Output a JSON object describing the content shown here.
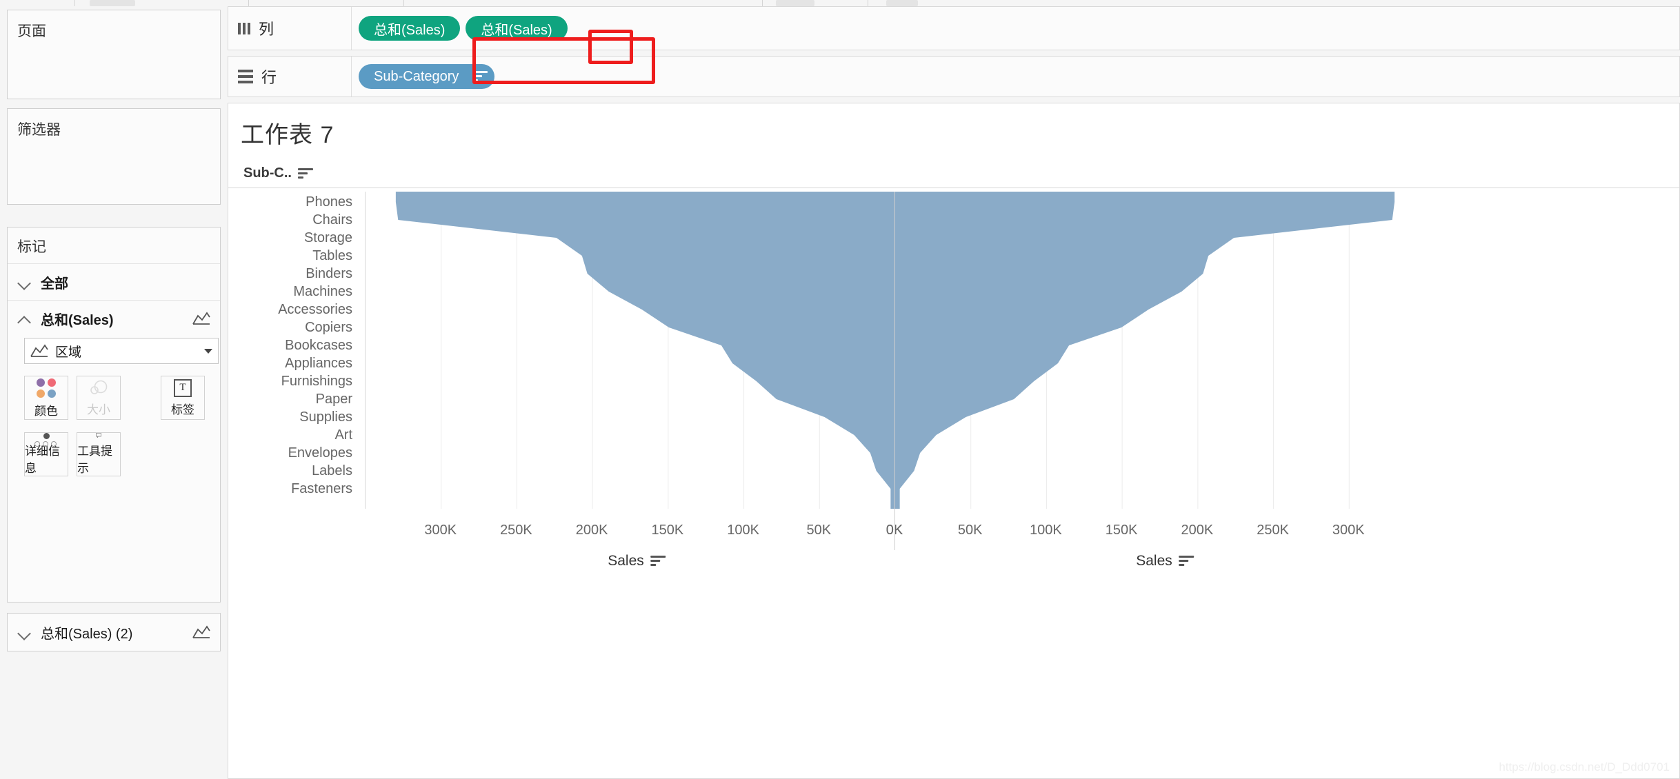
{
  "left_panel": {
    "pages": {
      "title": "页面"
    },
    "filters": {
      "title": "筛选器"
    },
    "marks": {
      "title": "标记",
      "group_all": "全部",
      "group_sales": "总和(Sales)",
      "group_sales2": "总和(Sales) (2)",
      "mark_type": "区域",
      "buttons": [
        {
          "label": "颜色",
          "icon": "color-dots-icon"
        },
        {
          "label": "大小",
          "icon": "size-circles-icon"
        },
        {
          "label": "标签",
          "icon": "label-t-icon"
        },
        {
          "label": "详细信息",
          "icon": "detail-dots-icon"
        },
        {
          "label": "工具提示",
          "icon": "tooltip-bubble-icon"
        }
      ]
    }
  },
  "shelves": {
    "columns": {
      "label": "列",
      "icon": "columns-icon",
      "pills": [
        {
          "text": "总和(Sales)",
          "color": "#0fa47f"
        },
        {
          "text": "总和(Sales)",
          "color": "#0fa47f"
        }
      ]
    },
    "rows": {
      "label": "行",
      "icon": "rows-icon",
      "pills": [
        {
          "text": "Sub-Category",
          "color": "#5b9bc4",
          "sorted": true
        }
      ]
    }
  },
  "worksheet": {
    "title": "工作表 7",
    "row_field_header": "Sub-C..",
    "watermark": "https://blog.csdn.net/D_Ddd0701"
  },
  "chart_data": {
    "type": "area",
    "title": "工作表 7",
    "orientation": "horizontal-mirrored-butterfly",
    "categories": [
      "Phones",
      "Chairs",
      "Storage",
      "Tables",
      "Binders",
      "Machines",
      "Accessories",
      "Copiers",
      "Bookcases",
      "Appliances",
      "Furnishings",
      "Paper",
      "Supplies",
      "Art",
      "Envelopes",
      "Labels",
      "Fasteners"
    ],
    "series": [
      {
        "name": "Sales (left, reversed axis)",
        "axis": "left",
        "values": [
          330007,
          328449,
          223844,
          206966,
          203413,
          189239,
          167380,
          149528,
          114880,
          107532,
          91705,
          78479,
          46674,
          27119,
          16476,
          12486,
          3024
        ]
      },
      {
        "name": "Sales (right axis)",
        "axis": "right",
        "values": [
          330007,
          328449,
          223844,
          206966,
          203413,
          189239,
          167380,
          149528,
          114880,
          107532,
          91705,
          78479,
          46674,
          27119,
          16476,
          12486,
          3024
        ]
      }
    ],
    "left_axis": {
      "title": "Sales",
      "ticks": [
        "300K",
        "250K",
        "200K",
        "150K",
        "100K",
        "50K",
        "0K"
      ],
      "tick_values": [
        300000,
        250000,
        200000,
        150000,
        100000,
        50000,
        0
      ],
      "reversed": true,
      "range": [
        0,
        350000
      ]
    },
    "right_axis": {
      "title": "Sales",
      "ticks": [
        "0K",
        "50K",
        "100K",
        "150K",
        "200K",
        "250K",
        "300K"
      ],
      "tick_values": [
        0,
        50000,
        100000,
        150000,
        200000,
        250000,
        300000
      ],
      "reversed": false,
      "range": [
        0,
        350000
      ]
    },
    "ylabel": "Sub-Category",
    "xlabel": "Sales",
    "grid": true,
    "legend": "none",
    "mark_color": "#8aabc8"
  },
  "annotations": [
    {
      "name": "rows-shelf-highlight",
      "color": "#ee1d1d"
    },
    {
      "name": "sort-button-highlight",
      "color": "#ee1d1d"
    }
  ]
}
